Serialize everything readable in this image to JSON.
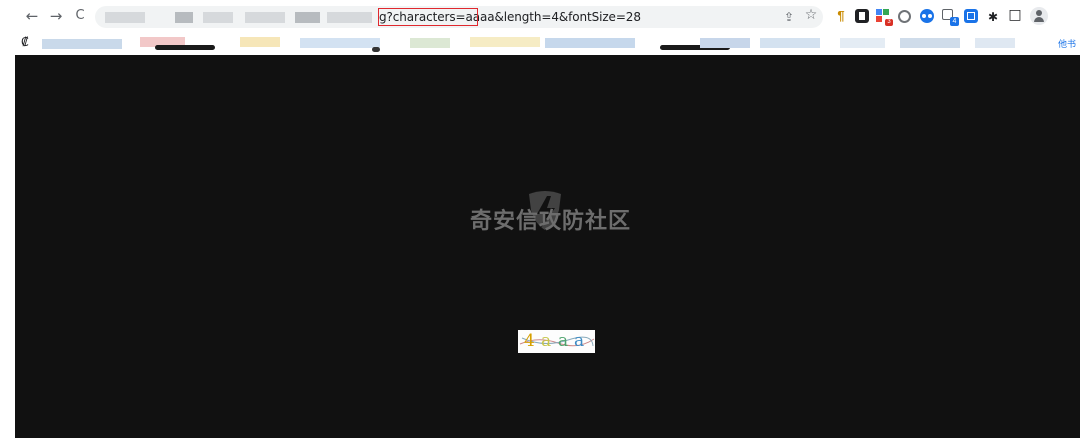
{
  "toolbar": {
    "back_icon": "←",
    "forward_icon": "→",
    "reload_icon": "C",
    "url": "g?characters=aaaa&length=4&fontSize=28",
    "share_icon": "⇪",
    "star_icon": "☆",
    "extensions_icon": "✱",
    "side_panel_icon": "□",
    "profile_icon": "👤",
    "ext_icons": [
      "pilcrow-ext",
      "notion-ext",
      "grid-ext",
      "circle-ext",
      "glasses-ext",
      "translate-ext",
      "calc-ext"
    ],
    "ext_badge_red": "3",
    "ext_badge_blue": "4"
  },
  "bookmarks": {
    "leading_icon": "₡",
    "overflow_label": "他书"
  },
  "watermark": {
    "text": "奇安信攻防社区"
  },
  "captcha": {
    "characters": [
      "4",
      "a",
      "a",
      "a"
    ],
    "colors": [
      "#d6a000",
      "#c7c64a",
      "#4da36c",
      "#3c8ac4"
    ]
  }
}
